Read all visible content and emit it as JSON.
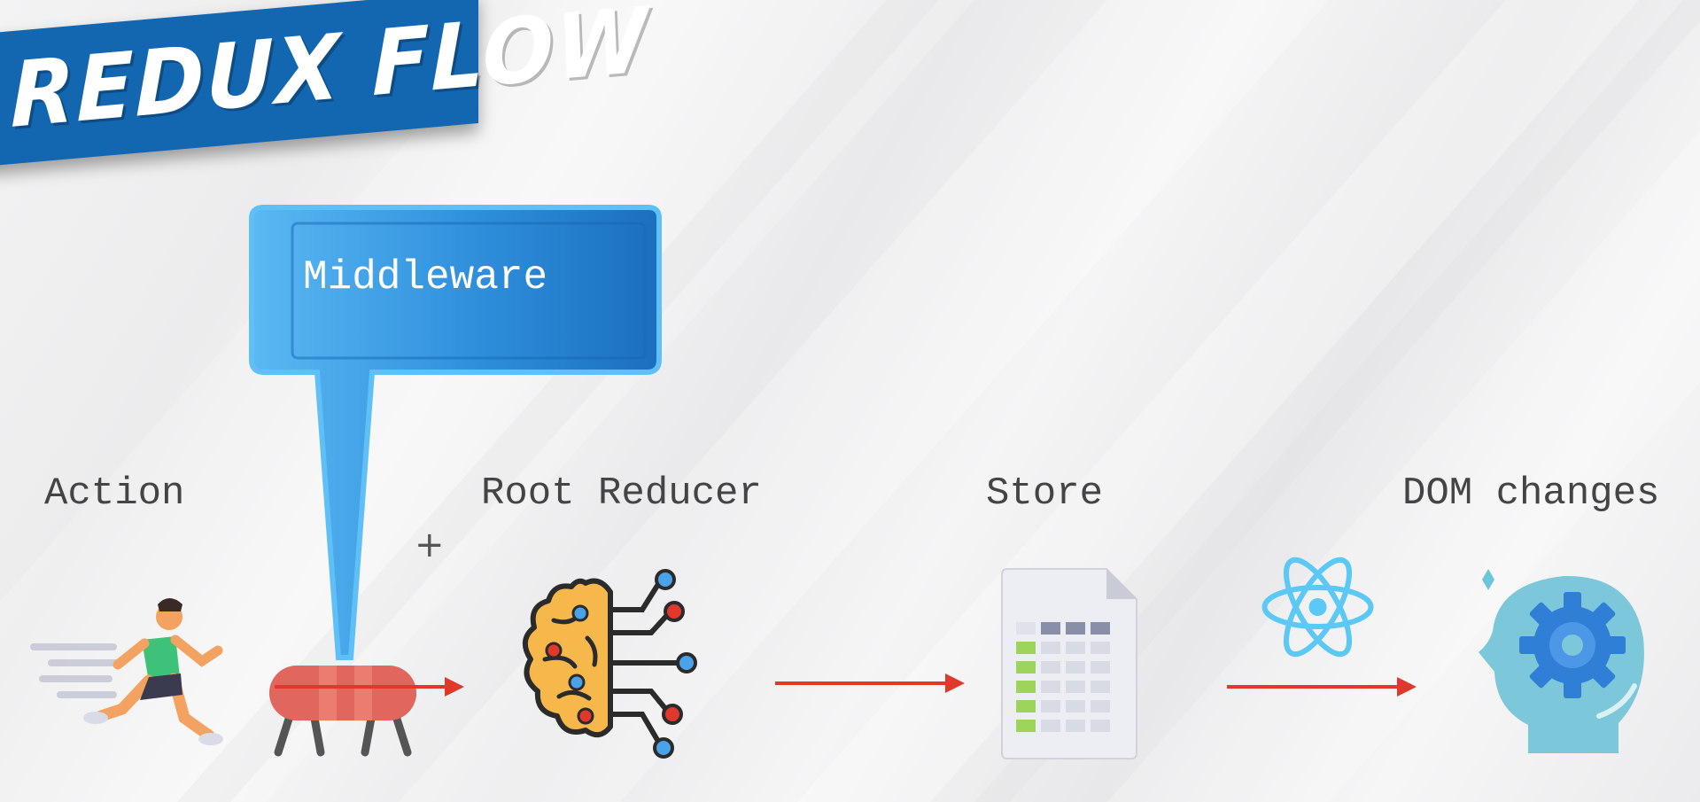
{
  "title": "REDUX FLOW",
  "callout": "Middleware",
  "steps": {
    "action": "Action",
    "reducer": "Root Reducer",
    "store": "Store",
    "dom": "DOM changes"
  },
  "plus": "+",
  "icons": {
    "action": "runner-icon",
    "middleware": "pommel-horse-icon",
    "reducer": "brain-circuit-icon",
    "store": "spreadsheet-document-icon",
    "react": "react-logo-icon",
    "dom": "head-gear-icon"
  },
  "colors": {
    "banner": "#1367b1",
    "callout": "#3ba3ea",
    "arrow": "#e0392b",
    "react": "#5bc8f5"
  }
}
